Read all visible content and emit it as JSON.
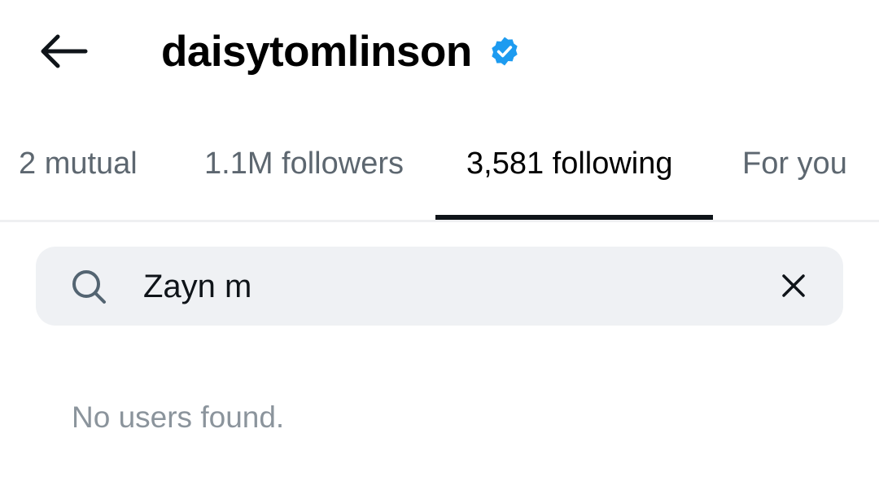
{
  "header": {
    "back_icon": "arrow-left-icon",
    "username": "daisytomlinson",
    "verified_icon": "verified-badge-icon",
    "verified_color": "#1d9bf0"
  },
  "tabs": [
    {
      "label": "2 mutual",
      "active": false
    },
    {
      "label": "1.1M followers",
      "active": false
    },
    {
      "label": "3,581 following",
      "active": true
    },
    {
      "label": "For you",
      "active": false
    }
  ],
  "search": {
    "icon": "search-icon",
    "value": "Zayn m",
    "clear_icon": "close-icon"
  },
  "results": {
    "empty_message": "No users found."
  }
}
